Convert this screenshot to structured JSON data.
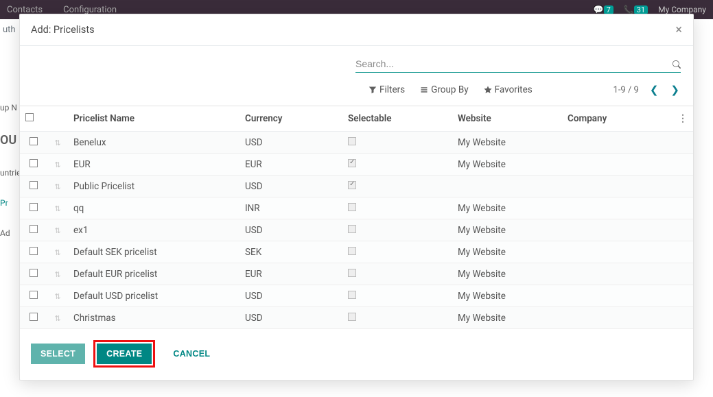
{
  "bg": {
    "menu1": "Contacts",
    "menu2": "Configuration",
    "badge1": "7",
    "badge2": "31",
    "company": "My Company",
    "sub1": "uth",
    "left_labels": [
      "up N",
      "OU",
      "untrie",
      "Pr",
      "Ad"
    ]
  },
  "modal": {
    "title": "Add: Pricelists"
  },
  "search": {
    "placeholder": "Search..."
  },
  "controls": {
    "filters": "Filters",
    "group_by": "Group By",
    "favorites": "Favorites",
    "pager": "1-9 / 9"
  },
  "columns": {
    "name": "Pricelist Name",
    "currency": "Currency",
    "selectable": "Selectable",
    "website": "Website",
    "company": "Company"
  },
  "rows": [
    {
      "name": "Benelux",
      "currency": "USD",
      "selectable": false,
      "website": "My Website",
      "company": ""
    },
    {
      "name": "EUR",
      "currency": "EUR",
      "selectable": true,
      "website": "My Website",
      "company": ""
    },
    {
      "name": "Public Pricelist",
      "currency": "USD",
      "selectable": true,
      "website": "",
      "company": ""
    },
    {
      "name": "qq",
      "currency": "INR",
      "selectable": false,
      "website": "My Website",
      "company": ""
    },
    {
      "name": "ex1",
      "currency": "USD",
      "selectable": false,
      "website": "My Website",
      "company": ""
    },
    {
      "name": "Default SEK pricelist",
      "currency": "SEK",
      "selectable": false,
      "website": "My Website",
      "company": ""
    },
    {
      "name": "Default EUR pricelist",
      "currency": "EUR",
      "selectable": false,
      "website": "My Website",
      "company": ""
    },
    {
      "name": "Default USD pricelist",
      "currency": "USD",
      "selectable": false,
      "website": "My Website",
      "company": ""
    },
    {
      "name": "Christmas",
      "currency": "USD",
      "selectable": false,
      "website": "My Website",
      "company": ""
    }
  ],
  "footer": {
    "select": "Select",
    "create": "Create",
    "cancel": "Cancel"
  }
}
